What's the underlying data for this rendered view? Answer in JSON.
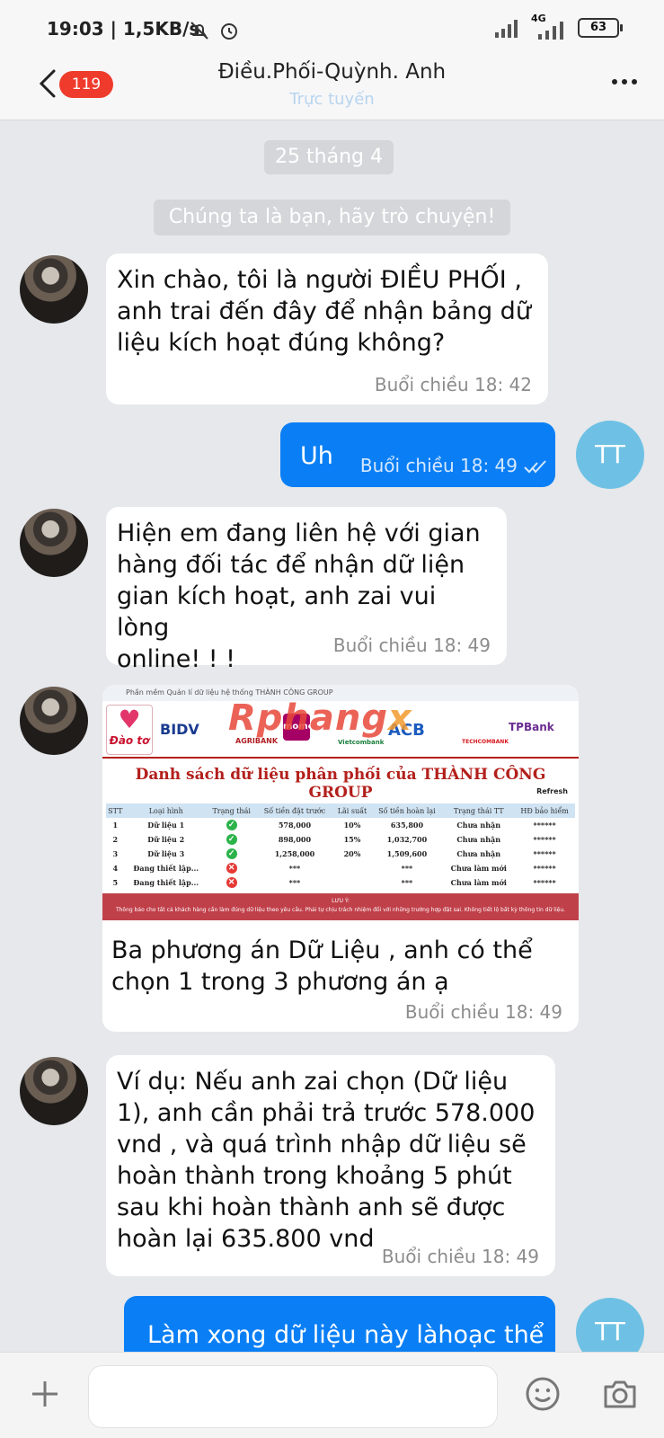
{
  "status": {
    "time": "19:03",
    "speed": "1,5KB/s",
    "network": "4G",
    "battery": "63"
  },
  "header": {
    "badge": "119",
    "title": "Điều.Phối-Quỳnh. Anh",
    "subtitle": "Trực tuyến"
  },
  "chat": {
    "date": "25 tháng 4",
    "info": "Chúng ta là bạn, hãy trò chuyện!",
    "messages": [
      {
        "lines": [
          "Xin chào, tôi là người ĐIỀU PHỐI ,",
          "anh trai  đến đây để nhận bảng dữ",
          "liệu kích hoạt đúng không?"
        ],
        "time": "Buổi chiều  18: 42"
      },
      {
        "text": "Uh",
        "time": "Buổi chiều  18: 49",
        "avatar": "TT"
      },
      {
        "lines": [
          "Hiện em đang liên hệ với gian",
          "hàng đối tác để nhận dữ liện",
          "gian kích hoạt, anh zai vui lòng",
          "online! ! !"
        ],
        "time": "Buổi chiều  18: 49"
      },
      {
        "lines": [
          "Ba phương án Dữ Liệu , anh có thể",
          "chọn 1 trong 3 phương án ạ"
        ],
        "time": "Buổi chiều  18: 49"
      },
      {
        "lines": [
          "Ví dụ: Nếu anh zai chọn (Dữ liệu",
          "1), anh cần phải trả trước 578.000",
          "vnd , và quá trình nhập dữ liệu sẽ",
          "hoàn thành trong khoảng 5 phút",
          "sau khi hoàn thành anh sẽ được",
          "hoàn lại 635.800 vnd"
        ],
        "time": "Buổi chiều  18: 49"
      },
      {
        "text": "Làm xong dữ liệu này làhoạc thể",
        "avatar": "TT"
      }
    ]
  },
  "shared_image": {
    "window_title": "Phần mềm Quản lí dữ liệu hệ thống THÀNH CÔNG GROUP",
    "watermark": "Rphang",
    "watermark_x": "x",
    "dao_to": "Đào tơ",
    "banks": [
      "BIDV",
      "AGRIBANK",
      "momo",
      "Vietcombank",
      "ACB",
      "TECHCOMBANK",
      "TPBank"
    ],
    "list_title": "Danh sách dữ liệu phân phối của THÀNH CÔNG GROUP",
    "refresh": "Refresh",
    "columns": [
      "STT",
      "Loại hình",
      "Trạng thái",
      "Số tiền đặt trước",
      "Lãi suất",
      "Số tiền hoàn lại",
      "Trạng thái TT",
      "HĐ bảo hiểm"
    ],
    "rows": [
      [
        "1",
        "Dữ liệu 1",
        "ok",
        "578,000",
        "10%",
        "635,800",
        "Chưa nhận",
        "******"
      ],
      [
        "2",
        "Dữ liệu 2",
        "ok",
        "898,000",
        "15%",
        "1,032,700",
        "Chưa nhận",
        "******"
      ],
      [
        "3",
        "Dữ liệu 3",
        "ok",
        "1,258,000",
        "20%",
        "1,509,600",
        "Chưa nhận",
        "******"
      ],
      [
        "4",
        "Đang thiết lập...",
        "bad",
        "***",
        "",
        "***",
        "Chưa làm mới",
        "******"
      ],
      [
        "5",
        "Đang thiết lập...",
        "bad",
        "***",
        "",
        "***",
        "Chưa làm mới",
        "******"
      ]
    ],
    "note_title": "LƯU Ý:",
    "note": "Thông báo cho tất cả khách hàng cần làm đúng dữ liệu theo yêu cầu. Phải tự chịu trách nhiệm đối với những trường hợp đặt sai. Không tiết lộ bất kỳ thông tin dữ liệu."
  },
  "colors": {
    "accent": "#0a7ff5",
    "badge": "#ef3b2c",
    "online": "#b8d4ef"
  }
}
